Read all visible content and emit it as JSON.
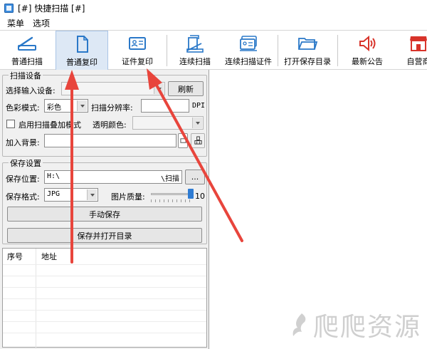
{
  "window": {
    "title": "[#] 快捷扫描 [#]"
  },
  "menu": {
    "items": [
      "菜单",
      "选项"
    ]
  },
  "toolbar": {
    "buttons": [
      {
        "label": "普通扫描",
        "icon": "scanner-icon"
      },
      {
        "label": "普通复印",
        "icon": "document-icon"
      },
      {
        "label": "证件复印",
        "icon": "id-card-icon"
      },
      {
        "label": "连续扫描",
        "icon": "stack-scan-icon"
      },
      {
        "label": "连续扫描证件",
        "icon": "stack-id-icon"
      },
      {
        "label": "打开保存目录",
        "icon": "folder-icon"
      },
      {
        "label": "最新公告",
        "icon": "megaphone-icon"
      },
      {
        "label": "自营商",
        "icon": "store-icon"
      }
    ]
  },
  "scan_settings": {
    "group_title": "扫描设备",
    "device_label": "选择输入设备:",
    "device_value": "",
    "refresh_label": "刷新",
    "color_mode_label": "色彩模式:",
    "color_mode_value": "彩色",
    "resolution_label": "扫描分辨率:",
    "resolution_value": "",
    "resolution_unit": "DPI",
    "overlay_label": "启用扫描叠加模式",
    "transparent_label": "透明颜色:",
    "background_label": "加入背景:",
    "background_value": ""
  },
  "save_settings": {
    "group_title": "保存设置",
    "location_label": "保存位置:",
    "location_value": "H:\\",
    "location_suffix": "\\扫描",
    "browse_label": "...",
    "format_label": "保存格式:",
    "format_value": "JPG",
    "quality_label": "图片质量:",
    "quality_value": "10",
    "manual_save_label": "手动保存",
    "save_open_label": "保存并打开目录"
  },
  "file_table": {
    "columns": [
      "序号",
      "地址"
    ],
    "rows": []
  },
  "watermark": {
    "text": "爬爬资源"
  },
  "colors": {
    "accent": "#2f7cd3",
    "arrow": "#e8453c",
    "toolbar_active": "#dde8f5"
  }
}
